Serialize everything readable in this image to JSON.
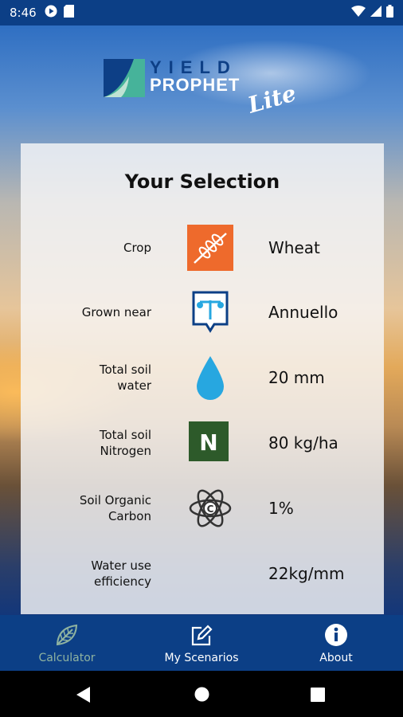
{
  "status": {
    "time": "8:46"
  },
  "logo": {
    "line1": "YIELD",
    "line2": "PROPHET",
    "line3": "Lite"
  },
  "selection": {
    "title": "Your Selection",
    "rows": [
      {
        "label": "Crop",
        "value": "Wheat",
        "icon": "wheat-icon"
      },
      {
        "label": "Grown near",
        "value": "Annuello",
        "icon": "weather-station-icon"
      },
      {
        "label": "Total soil\nwater",
        "value": "20 mm",
        "icon": "water-drop-icon"
      },
      {
        "label": "Total soil\nNitrogen",
        "value": "80 kg/ha",
        "icon": "nitrogen-icon",
        "icon_text": "N"
      },
      {
        "label": "Soil Organic\nCarbon",
        "value": "1%",
        "icon": "carbon-atom-icon",
        "icon_text": "C"
      },
      {
        "label": "Water use\nefficiency",
        "value": "22kg/mm"
      }
    ]
  },
  "nav": {
    "items": [
      {
        "label": "Calculator",
        "icon": "leaf-icon",
        "active": true
      },
      {
        "label": "My Scenarios",
        "icon": "edit-icon",
        "active": false
      },
      {
        "label": "About",
        "icon": "info-icon",
        "active": false
      }
    ]
  },
  "colors": {
    "primary": "#0c3f86",
    "active_nav": "#8fb3a0",
    "wheat_tile": "#ee6a2c",
    "nitrogen_tile": "#2d5a2a",
    "water": "#27a7e0"
  }
}
